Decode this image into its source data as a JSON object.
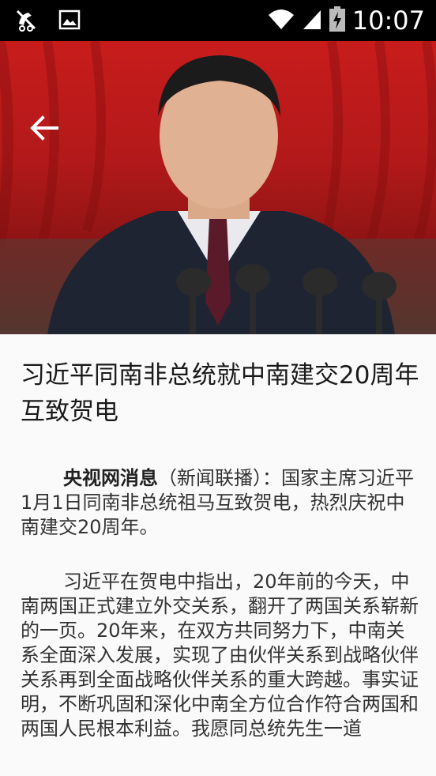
{
  "status_bar": {
    "time": "10:07",
    "left_icons": [
      "notification-muted-icon",
      "image-icon"
    ],
    "right_icons": [
      "wifi-icon",
      "cell-signal-icon",
      "battery-charging-icon"
    ]
  },
  "header": {
    "back_icon": "arrow-back-icon"
  },
  "article": {
    "title": "习近平同南非总统就中南建交20周年互致贺电",
    "paragraph1_lead": "央视网消息",
    "paragraph1_body": "（新闻联播）：国家主席习近平1月1日同南非总统祖马互致贺电，热烈庆祝中南建交20周年。",
    "paragraph2": "习近平在贺电中指出，20年前的今天，中南两国正式建立外交关系，翻开了两国关系崭新的一页。20年来，在双方共同努力下，中南关系全面深入发展，实现了由伙伴关系到战略伙伴关系再到全面战略伙伴关系的重大跨越。事实证明，不断巩固和深化中南全方位合作符合两国和两国人民根本利益。我愿同总统先生一道"
  },
  "colors": {
    "hero_red": "#c81c1c",
    "status_bar": "#000000",
    "background": "#fafafa"
  }
}
